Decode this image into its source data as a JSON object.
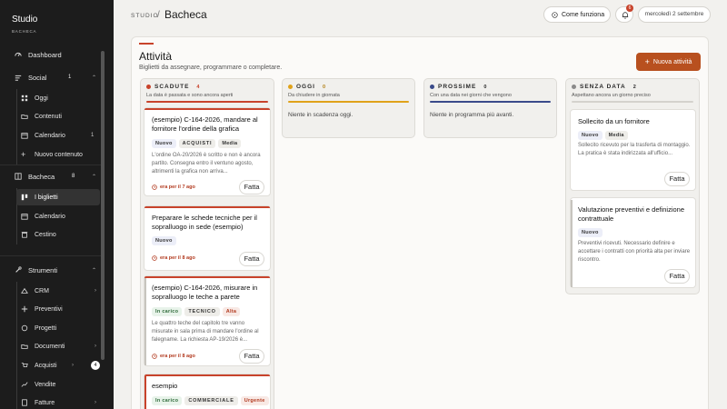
{
  "sidebar": {
    "brand": "Studio",
    "brand_sub": "BACHECA",
    "dashboard": "Dashboard",
    "social": {
      "label": "Social",
      "count": "1",
      "items": [
        {
          "label": "Oggi"
        },
        {
          "label": "Contenuti"
        },
        {
          "label": "Calendario",
          "count": "1"
        },
        {
          "label": "Nuovo contenuto"
        }
      ]
    },
    "bacheca": {
      "label": "Bacheca",
      "count": "8",
      "items": [
        {
          "label": "I biglietti"
        },
        {
          "label": "Calendario"
        },
        {
          "label": "Cestino"
        }
      ]
    },
    "strumenti": {
      "label": "Strumenti",
      "items": [
        {
          "label": "CRM"
        },
        {
          "label": "Preventivi"
        },
        {
          "label": "Progetti"
        },
        {
          "label": "Documenti"
        },
        {
          "label": "Acquisti",
          "count": "4"
        },
        {
          "label": "Vendite"
        },
        {
          "label": "Fatture"
        }
      ]
    }
  },
  "header": {
    "crumb": "STUDIO",
    "sep": "/",
    "title": "Bacheca",
    "how": "Come funziona",
    "notif_count": "6",
    "date": "mercoledì 2 settembre"
  },
  "panel": {
    "title": "Attività",
    "subtitle": "Biglietti da assegnare, programmare o completare.",
    "new_button": "Nuova attività"
  },
  "columns": [
    {
      "title": "SCADUTE",
      "count": "4",
      "desc": "La data è passata e sono ancora aperti",
      "color": "#c8432b"
    },
    {
      "title": "OGGI",
      "count": "0",
      "desc": "Da chiudere in giornata",
      "color": "#e0a21a",
      "empty": "Niente in scadenza oggi."
    },
    {
      "title": "PROSSIME",
      "count": "0",
      "desc": "Con una data nei giorni che vengono",
      "color": "#3a4a8a",
      "empty": "Niente in programma più avanti."
    },
    {
      "title": "SENZA DATA",
      "count": "2",
      "desc": "Aspettano ancora un giorno preciso",
      "color": "#8a8a8a"
    }
  ],
  "cards_overdue": [
    {
      "title": "(esempio) C-164-2026, mandare al fornitore l'ordine della grafica",
      "tags": [
        "Nuovo",
        "ACQUISTI",
        "Media"
      ],
      "body": "L'ordine OA-20/2026 è scritto e non è ancora partito. Consegna entro il ventuno agosto, altrimenti la grafica non arriva...",
      "overdue": "era per il 7 ago",
      "done": "Fatta"
    },
    {
      "title": "Preparare le schede tecniche per il sopralluogo in sede (esempio)",
      "tags": [
        "Nuovo"
      ],
      "body": "",
      "overdue": "era per il 8 ago",
      "done": "Fatta"
    },
    {
      "title": "(esempio) C-164-2026, misurare in sopralluogo le teche a parete",
      "tags": [
        "In carico",
        "TECNICO",
        "Alta"
      ],
      "body": "Le quattro teche del capitolo tre vanno misurate in sala prima di mandare l'ordine al falegname. La richiesta AP-19/2026 è...",
      "overdue": "era per il 8 ago",
      "done": "Fatta"
    },
    {
      "title": "esempio",
      "tags": [
        "In carico",
        "COMMERCIALE",
        "Urgente"
      ],
      "body": "",
      "overdue": "",
      "done": ""
    }
  ],
  "cards_nodate": [
    {
      "title": "Sollecito da un fornitore",
      "tags": [
        "Nuovo",
        "Media"
      ],
      "body": "Sollecito ricevuto per la trasferta di montaggio. La pratica è stata indirizzata all'ufficio...",
      "done": "Fatta"
    },
    {
      "title": "Valutazione preventivi e definizione contrattuale",
      "tags": [
        "Nuovo"
      ],
      "body": "Preventivi ricevuti. Necessario definire e accettare i contratti con priorità alta per inviare riscontro.",
      "done": "Fatta"
    }
  ]
}
